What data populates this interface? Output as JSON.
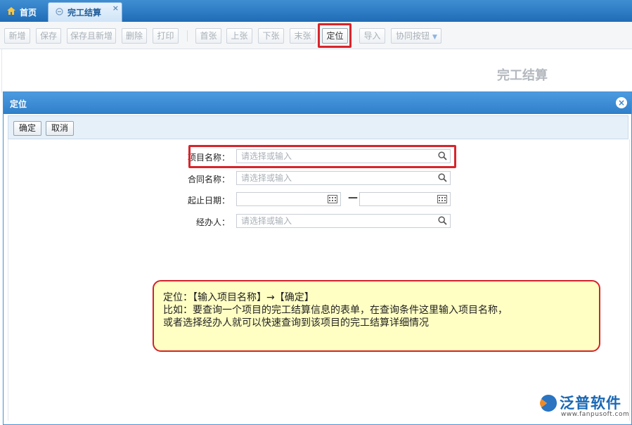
{
  "tabs": {
    "home": {
      "label": "首页",
      "icon": "home-icon"
    },
    "active": {
      "label": "完工结算",
      "icon": "page-icon",
      "close": "×"
    }
  },
  "toolbar": {
    "new": "新增",
    "save": "保存",
    "save_and_new": "保存且新增",
    "delete": "删除",
    "print": "打印",
    "first": "首张",
    "prev": "上张",
    "next": "下张",
    "last": "末张",
    "locate": "定位",
    "import": "导入",
    "collab": "协同按钮"
  },
  "page": {
    "title": "完工结算"
  },
  "dialog": {
    "title": "定位",
    "confirm": "确定",
    "cancel": "取消",
    "fields": {
      "project_name": {
        "label": "项目名称：",
        "placeholder": "请选择或输入"
      },
      "contract_name": {
        "label": "合同名称：",
        "placeholder": "请选择或输入"
      },
      "date_range": {
        "label": "起止日期：",
        "separator": "—"
      },
      "handler": {
        "label": "经办人：",
        "placeholder": "请选择或输入"
      }
    }
  },
  "callout": {
    "line1": "定位：【输入项目名称】→【确定】",
    "line2": "比如：要查询一个项目的完工结算信息的表单，在查询条件这里输入项目名称，",
    "line3": "或者选择经办人就可以快速查询到该项目的完工结算详细情况"
  },
  "logo": {
    "name": "泛普软件",
    "url": "www.fanpusoft.com"
  },
  "colors": {
    "accent": "#2f7fca",
    "highlight": "#d8252b",
    "callout_bg": "#ffffc4"
  }
}
